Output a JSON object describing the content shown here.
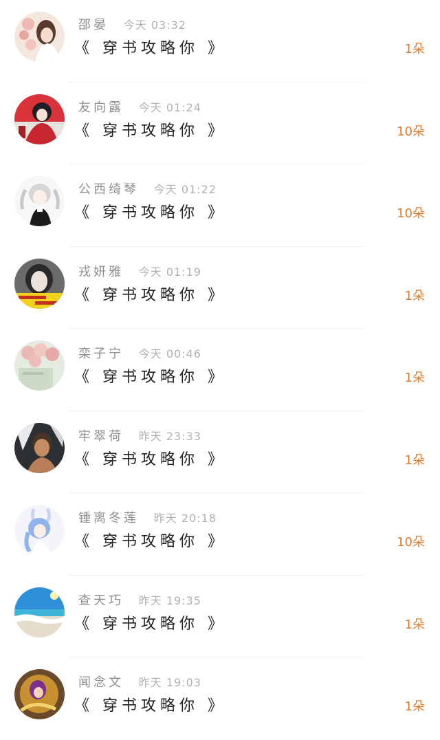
{
  "list": {
    "items": [
      {
        "name": "邵晏",
        "time": "今天 03:32",
        "book": "《 穿书攻略你 》",
        "count": "1朵",
        "avatar": "avatar-1"
      },
      {
        "name": "友向露",
        "time": "今天 01:24",
        "book": "《 穿书攻略你 》",
        "count": "10朵",
        "avatar": "avatar-2"
      },
      {
        "name": "公西绮琴",
        "time": "今天 01:22",
        "book": "《 穿书攻略你 》",
        "count": "10朵",
        "avatar": "avatar-3"
      },
      {
        "name": "戎妍雅",
        "time": "今天 01:19",
        "book": "《 穿书攻略你 》",
        "count": "1朵",
        "avatar": "avatar-4"
      },
      {
        "name": "栾子宁",
        "time": "今天 00:46",
        "book": "《 穿书攻略你 》",
        "count": "1朵",
        "avatar": "avatar-5"
      },
      {
        "name": "牢翠荷",
        "time": "昨天 23:33",
        "book": "《 穿书攻略你 》",
        "count": "1朵",
        "avatar": "avatar-6"
      },
      {
        "name": "锺离冬莲",
        "time": "昨天 20:18",
        "book": "《 穿书攻略你 》",
        "count": "10朵",
        "avatar": "avatar-7"
      },
      {
        "name": "查天巧",
        "time": "昨天 19:35",
        "book": "《 穿书攻略你 》",
        "count": "1朵",
        "avatar": "avatar-8"
      },
      {
        "name": "闻念文",
        "time": "昨天 19:03",
        "book": "《 穿书攻略你 》",
        "count": "1朵",
        "avatar": "avatar-9"
      }
    ]
  },
  "colors": {
    "count": "#e07a2a",
    "name": "#8f8f8f",
    "time": "#b0b0b0",
    "book": "#222222",
    "divider": "#f0f0f0"
  }
}
